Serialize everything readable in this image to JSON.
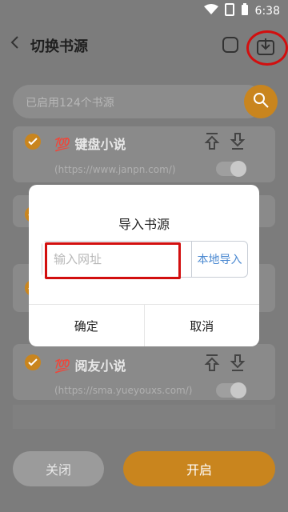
{
  "status": {
    "time": "6:38"
  },
  "header": {
    "title": "切换书源"
  },
  "search": {
    "placeholder": "已启用124个书源"
  },
  "cards": [
    {
      "name": "键盘小说",
      "url": "(https://www.janpn.com/)",
      "prefix": "💯"
    },
    {
      "name": "阅友小说",
      "url": "(https://sma.yueyouxs.com/)",
      "prefix": "💯"
    }
  ],
  "dialog": {
    "title": "导入书源",
    "input_placeholder": "输入网址",
    "local_import": "本地导入",
    "confirm": "确定",
    "cancel": "取消"
  },
  "footer": {
    "close": "关闭",
    "open": "开启"
  },
  "colors": {
    "accent": "#c9851e",
    "annotation": "#d20f0f",
    "link": "#4b89d1"
  }
}
